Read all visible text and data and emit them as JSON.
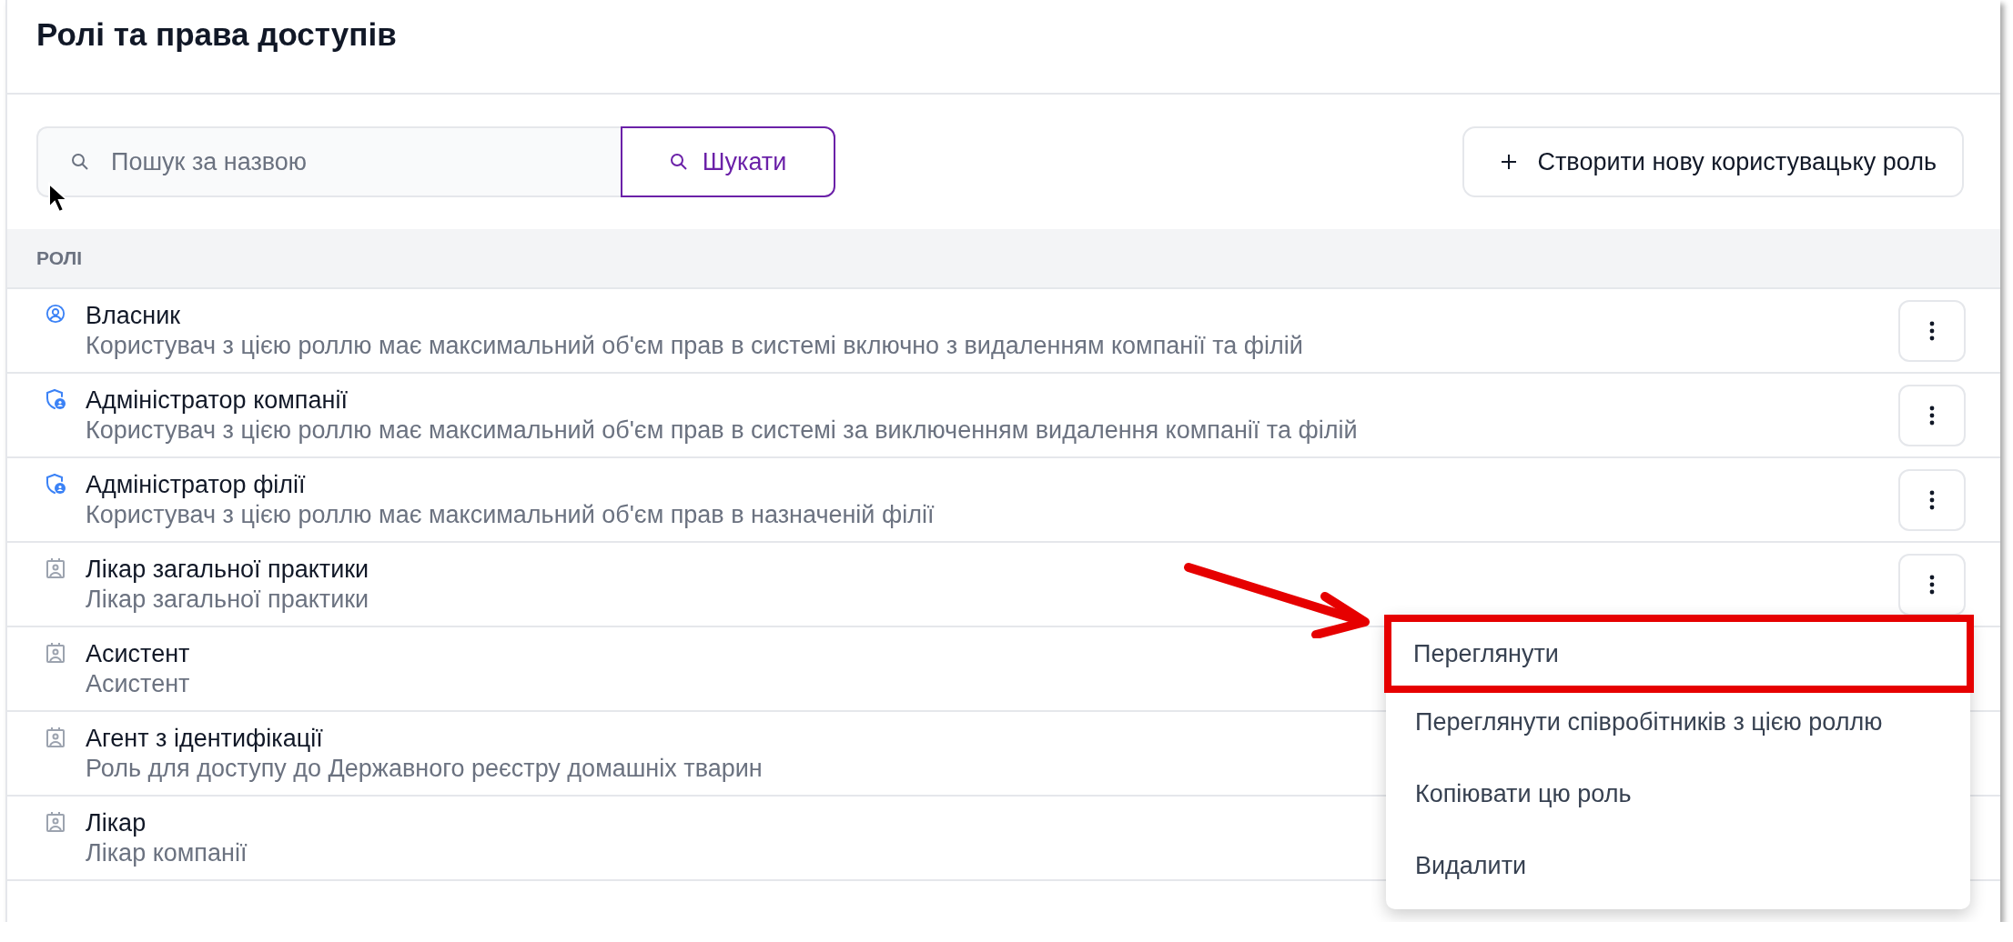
{
  "title": "Ролі та права доступів",
  "search": {
    "placeholder": "Пошук за назвою",
    "button": "Шукати"
  },
  "create_button": "Створити нову користувацьку роль",
  "section_header": "РОЛІ",
  "roles": [
    {
      "kind": "owner",
      "name": "Власник",
      "description": "Користувач з цією роллю має максимальний об'єм прав в системі включно з видаленням компанії та філій",
      "actions_button": true
    },
    {
      "kind": "admin",
      "name": "Адміністратор компанії",
      "description": "Користувач з цією роллю має максимальний об'єм прав в системі за виключенням видалення компанії та філій",
      "actions_button": true
    },
    {
      "kind": "admin",
      "name": "Адміністратор філії",
      "description": "Користувач з цією роллю має максимальний об'єм прав в назначеній філії",
      "actions_button": true
    },
    {
      "kind": "custom",
      "name": "Лікар загальної практики",
      "description": "Лікар загальної практики",
      "actions_button": true
    },
    {
      "kind": "custom",
      "name": "Асистент",
      "description": "Асистент",
      "actions_button": false
    },
    {
      "kind": "custom",
      "name": "Агент з ідентифікації",
      "description": "Роль для доступу до Державного реєстру домашніх тварин",
      "actions_button": false
    },
    {
      "kind": "custom",
      "name": "Лікар",
      "description": "Лікар компанії",
      "actions_button": false
    }
  ],
  "menu": {
    "items": [
      {
        "label": "Переглянути",
        "highlighted": true
      },
      {
        "label": "Переглянути співробітників з цією роллю",
        "highlighted": false
      },
      {
        "label": "Копіювати цю роль",
        "highlighted": false
      },
      {
        "label": "Видалити",
        "highlighted": false
      }
    ]
  }
}
